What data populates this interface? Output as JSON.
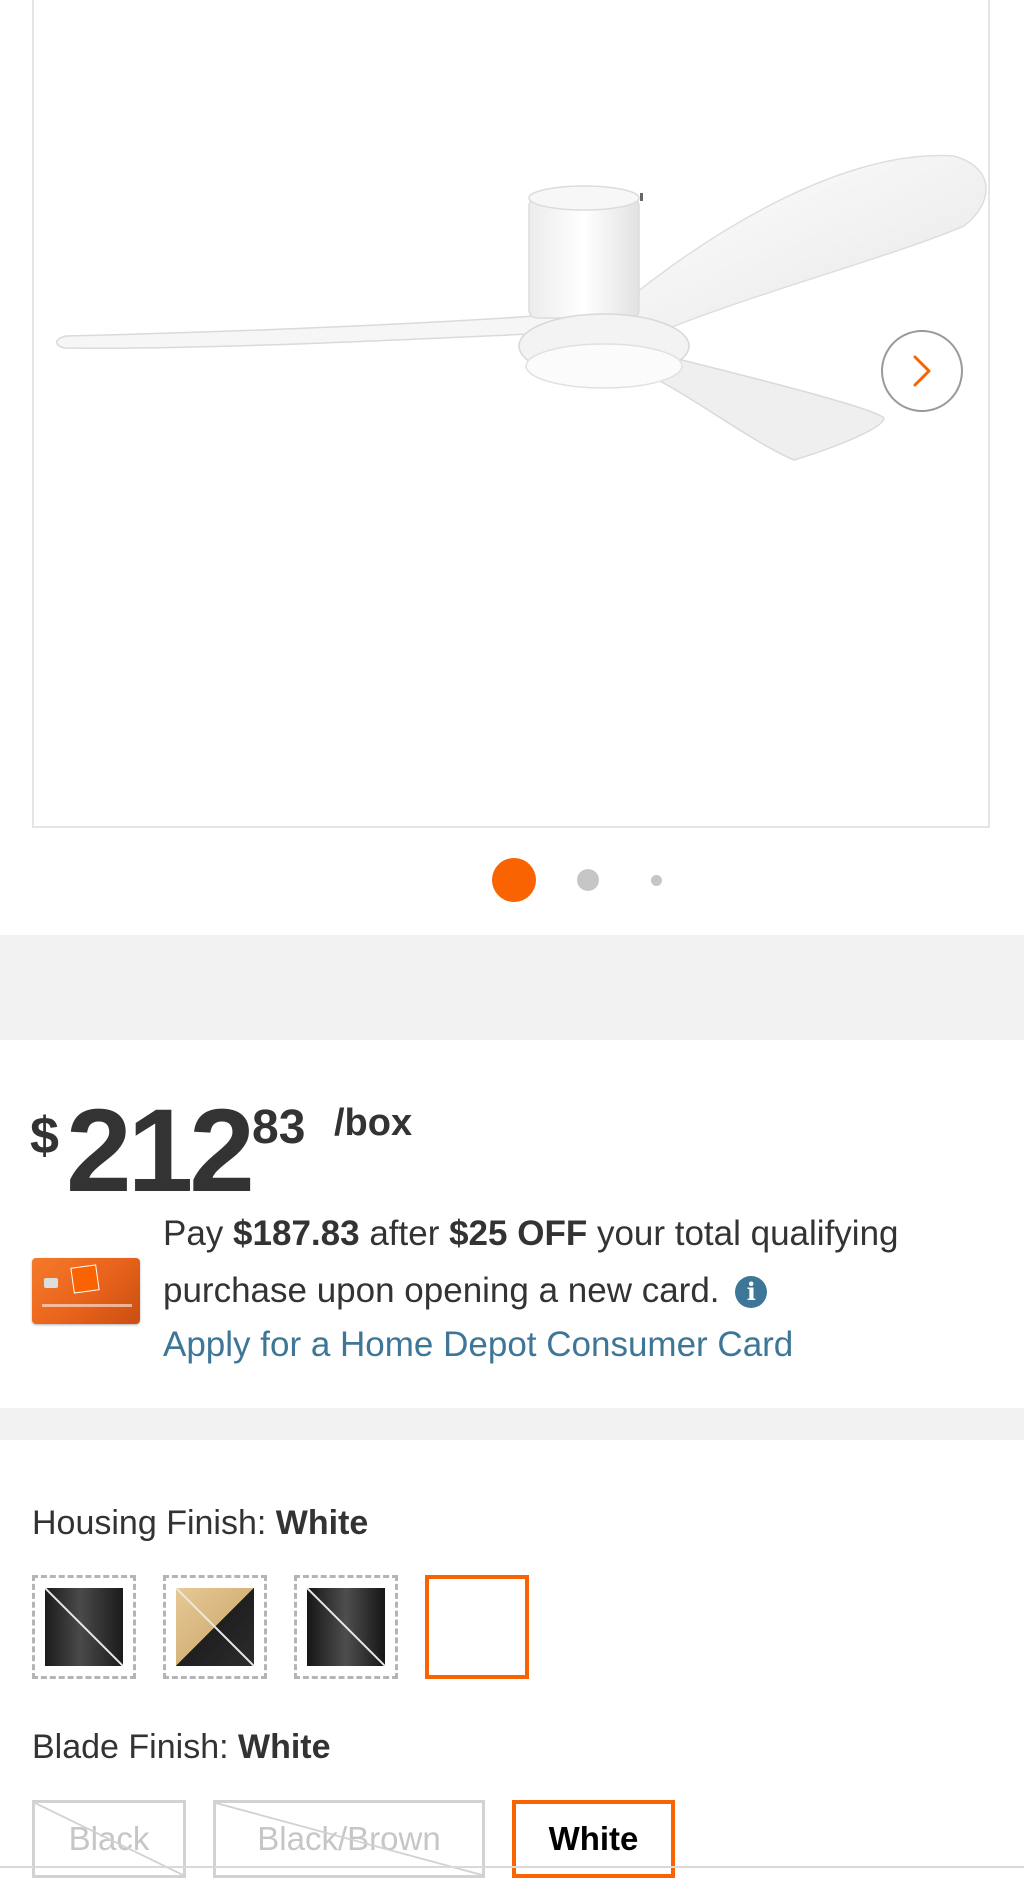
{
  "gallery": {
    "next_label": "Next image",
    "dots": 3,
    "active_dot": 1
  },
  "price": {
    "currency": "$",
    "whole": "212",
    "cents": "83",
    "unit": "/box"
  },
  "offer": {
    "pay_prefix": "Pay",
    "after_price": "$187.83",
    "after_word": "after",
    "discount": "$25 OFF",
    "text_tail": "your total qualifying purchase upon opening a new card.",
    "info_glyph": "i",
    "apply_link": "Apply for a Home Depot Consumer Card"
  },
  "housing_finish": {
    "label": "Housing Finish:",
    "selected": "White",
    "swatches": [
      "Black",
      "Brass/Black",
      "Black",
      "White"
    ]
  },
  "blade_finish": {
    "label": "Blade Finish:",
    "selected": "White",
    "options": [
      "Black",
      "Black/Brown",
      "White"
    ]
  },
  "colors": {
    "accent": "#f96302",
    "link": "#3e7697",
    "text": "#333333",
    "band": "#f2f2f2"
  }
}
